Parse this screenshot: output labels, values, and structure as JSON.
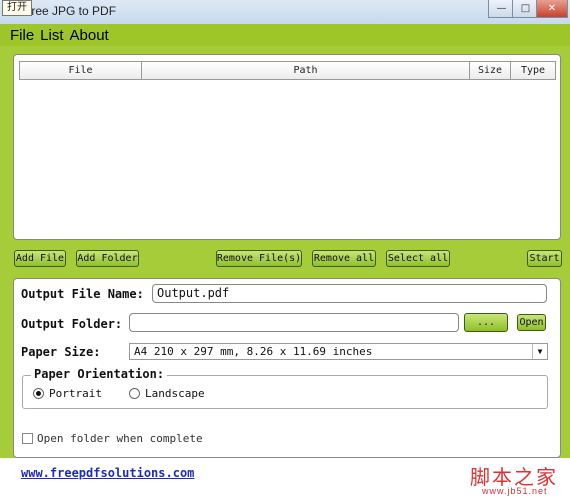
{
  "window": {
    "title": "Free JPG to PDF",
    "tooltip": "打开",
    "controls": {
      "minimize": "—",
      "maximize": "□",
      "close": "✕"
    }
  },
  "menu": [
    {
      "label": "File"
    },
    {
      "label": "List"
    },
    {
      "label": "About"
    }
  ],
  "file_list": {
    "columns": [
      "File",
      "Path",
      "Size",
      "Type"
    ]
  },
  "actions": {
    "add_file": "Add File",
    "add_folder": "Add Folder",
    "remove_files": "Remove File(s)",
    "remove_all": "Remove all",
    "select_all": "Select all",
    "start": "Start"
  },
  "settings": {
    "output_file_name_label": "Output File Name:",
    "output_file_name_value": "Output.pdf",
    "output_folder_label": "Output Folder:",
    "output_folder_value": "",
    "browse_label": "...",
    "open_label": "Open",
    "paper_size_label": "Paper Size:",
    "paper_size_value": "A4 210 x 297 mm, 8.26 x 11.69 inches",
    "orientation_label": "Paper Orientation:",
    "portrait_label": "Portrait",
    "landscape_label": "Landscape",
    "orientation_selected": "Portrait",
    "open_folder_label": "Open folder when complete",
    "open_folder_checked": false
  },
  "footer": {
    "website": "www.freepdfsolutions.com",
    "watermark_cn": "脚本之家",
    "watermark_url": "www.jb51.net"
  },
  "colors": {
    "app_green": "#a7cc3a",
    "button_green": "#8fbf2a",
    "link_blue": "#1e2db8",
    "watermark_red": "#d33333"
  }
}
